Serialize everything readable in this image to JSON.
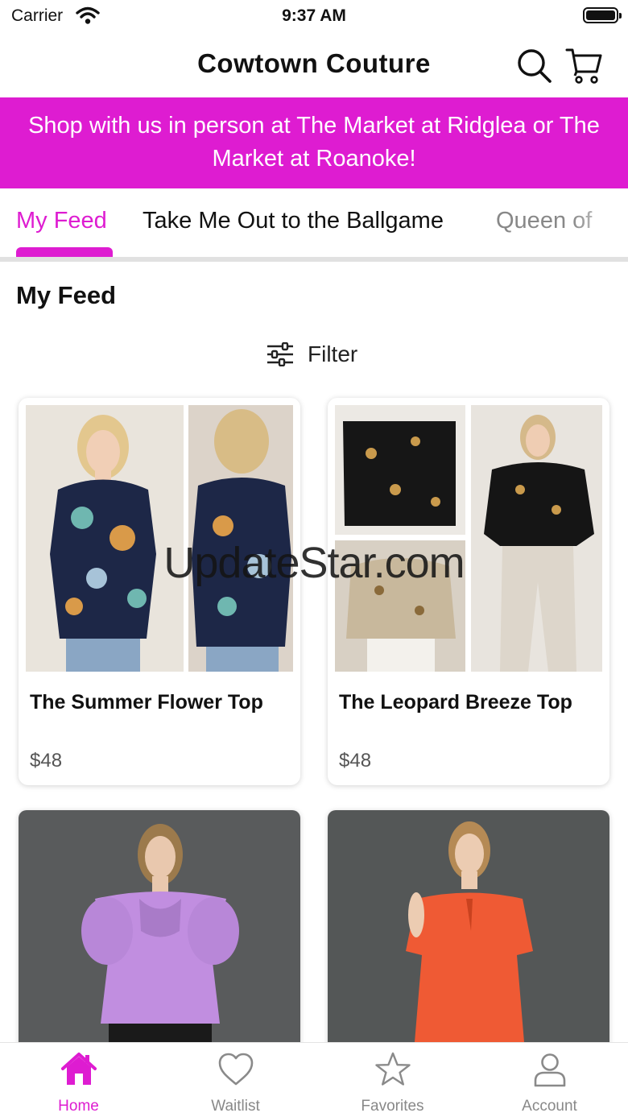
{
  "status_bar": {
    "carrier": "Carrier",
    "time": "9:37 AM"
  },
  "header": {
    "title": "Cowtown Couture",
    "search_icon": "search-icon",
    "cart_icon": "cart-icon"
  },
  "banner": {
    "text": "Shop with us in person at The Market at Ridglea or The Market at Roanoke!"
  },
  "tabs": [
    {
      "label": "My Feed",
      "active": true
    },
    {
      "label": "Take Me Out to the Ballgame",
      "active": false
    },
    {
      "label": "Queen of",
      "active": false
    }
  ],
  "feed": {
    "title": "My Feed",
    "filter_label": "Filter",
    "filter_icon": "sliders-icon"
  },
  "products": [
    {
      "name": "The Summer Flower Top",
      "price": "$48"
    },
    {
      "name": "The Leopard Breeze Top",
      "price": "$48"
    },
    {
      "name": "",
      "price": ""
    },
    {
      "name": "",
      "price": ""
    }
  ],
  "watermark": "UpdateStar.com",
  "tabbar": [
    {
      "label": "Home",
      "icon": "home-icon",
      "active": true
    },
    {
      "label": "Waitlist",
      "icon": "heart-icon",
      "active": false
    },
    {
      "label": "Favorites",
      "icon": "star-icon",
      "active": false
    },
    {
      "label": "Account",
      "icon": "user-icon",
      "active": false
    }
  ],
  "colors": {
    "accent": "#de1cd1",
    "inactive": "#888888",
    "text": "#111111"
  }
}
